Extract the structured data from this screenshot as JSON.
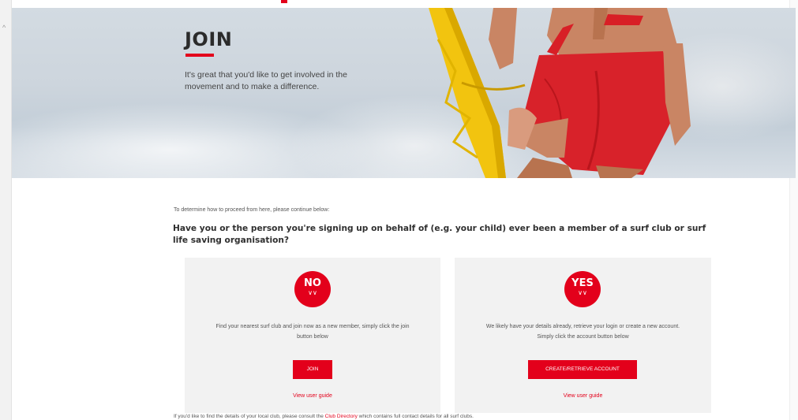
{
  "hero": {
    "title": "JOIN",
    "subtitle": "It's great that you'd like to get involved in the movement and to make a difference."
  },
  "intro": "To determine how to proceed from here, please continue below:",
  "question": "Have you or the person you're signing up on behalf of (e.g. your child) ever been a member of a surf club or surf life saving organisation?",
  "options": {
    "no": {
      "badge": "NO",
      "badge_icon": "double-chevron-down-icon",
      "description": "Find your nearest surf club and join now as a new member, simply click the join button below",
      "button": "JOIN",
      "guide_link": "View user guide"
    },
    "yes": {
      "badge": "YES",
      "badge_icon": "double-chevron-down-icon",
      "description": "We likely have your details already, retrieve your login or create a new account. Simply click the account button below",
      "button": "CREATE/RETRIEVE ACCOUNT",
      "guide_link": "View user guide"
    }
  },
  "footer": {
    "before": "If you'd like to find the details of your local club, please consult the ",
    "link": "Club Directory",
    "after": " which contains full contact details for all surf clubs."
  },
  "colors": {
    "accent": "#e3001b",
    "card_bg": "#f2f2f2",
    "heading": "#2b2b2b"
  }
}
